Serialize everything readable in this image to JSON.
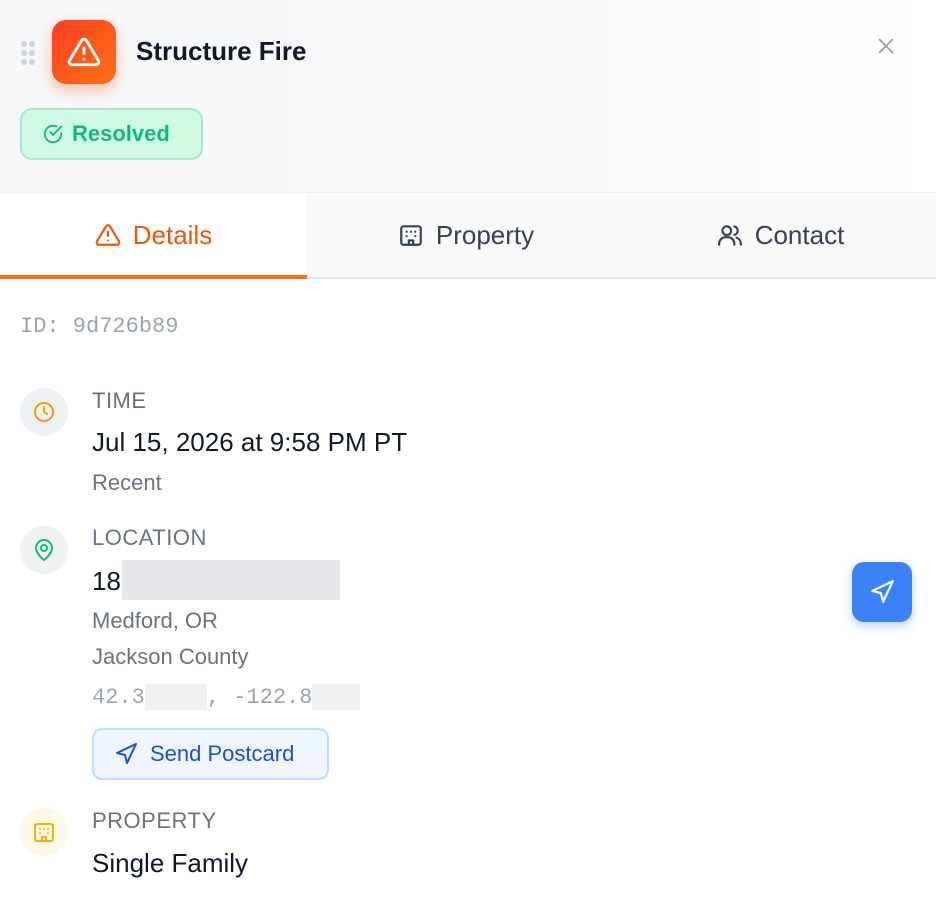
{
  "header": {
    "title": "Structure Fire",
    "status": "Resolved",
    "colors": {
      "accent": "#f97316",
      "resolved": "#10b981"
    },
    "icons": {
      "alert": "warning-triangle-icon",
      "close": "close-icon",
      "drag": "drag-handle-icon"
    }
  },
  "tabs": [
    {
      "label": "Details",
      "icon": "warning-triangle-icon",
      "active": true
    },
    {
      "label": "Property",
      "icon": "building-icon",
      "active": false
    },
    {
      "label": "Contact",
      "icon": "users-icon",
      "active": false
    }
  ],
  "details": {
    "id_text": "ID: 9d726b89",
    "time": {
      "label": "TIME",
      "value": "Jul 15, 2026 at 9:58 PM PT",
      "sub": "Recent"
    },
    "location": {
      "label": "LOCATION",
      "address_visible": "18",
      "city": "Medford, OR",
      "county": "Jackson County",
      "lat_visible": "42.3",
      "lon_visible": ", -122.8",
      "send_postcard_label": "Send Postcard"
    },
    "property": {
      "label": "PROPERTY",
      "value": "Single Family"
    }
  }
}
